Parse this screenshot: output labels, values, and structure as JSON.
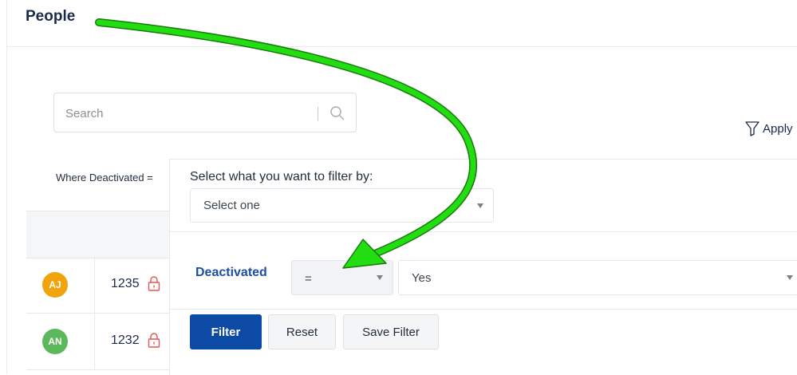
{
  "header": {
    "title": "People"
  },
  "search": {
    "placeholder": "Search"
  },
  "toolbar": {
    "apply_label": "Apply"
  },
  "active_filter": {
    "text": "Where Deactivated ="
  },
  "rows": [
    {
      "initials": "AJ",
      "avatar_color": "#f0a30a",
      "id": "1235"
    },
    {
      "initials": "AN",
      "avatar_color": "#5cb85c",
      "id": "1232"
    }
  ],
  "filter_panel": {
    "prompt": "Select what you want to filter by:",
    "field_select": "Select one",
    "field_label": "Deactivated",
    "operator": "=",
    "value": "Yes",
    "filter_button": "Filter",
    "reset_button": "Reset",
    "save_button": "Save Filter"
  },
  "colors": {
    "primary": "#0d4aa6",
    "field_label": "#1d4ea0",
    "lock": "#e25555",
    "annotation_arrow": "#22dd11"
  }
}
